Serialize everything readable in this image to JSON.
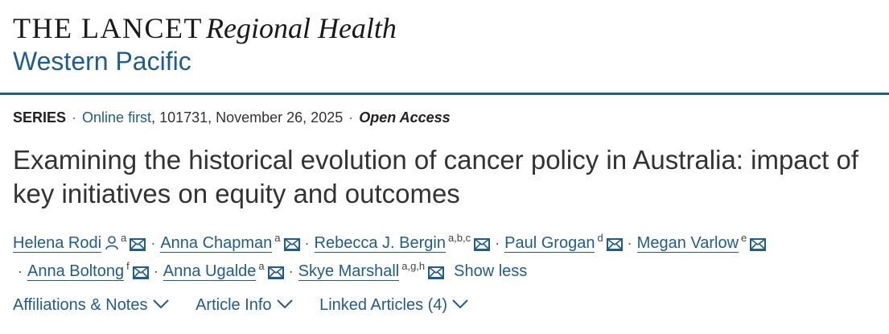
{
  "journal": {
    "name": "THE LANCET",
    "sub": "Regional Health",
    "region": "Western Pacific"
  },
  "meta": {
    "type": "SERIES",
    "online_first": "Online first",
    "details": ", 101731, November 26, 2025",
    "open_access": "Open Access"
  },
  "article": {
    "title": "Examining the historical evolution of cancer policy in Australia: impact of key initiatives on equity and outcomes"
  },
  "authors": [
    {
      "name": "Helena Rodi",
      "affil": "a"
    },
    {
      "name": "Anna Chapman",
      "affil": "a"
    },
    {
      "name": "Rebecca J. Bergin",
      "affil": "a,b,c"
    },
    {
      "name": "Paul Grogan",
      "affil": "d"
    },
    {
      "name": "Megan Varlow",
      "affil": "e"
    },
    {
      "name": "Anna Boltong",
      "affil": "f"
    },
    {
      "name": "Anna Ugalde",
      "affil": "a"
    },
    {
      "name": "Skye Marshall",
      "affil": "a,g,h"
    }
  ],
  "show_less": "Show less",
  "tabs": [
    {
      "label": "Affiliations & Notes"
    },
    {
      "label": "Article Info"
    },
    {
      "label": "Linked Articles (4)"
    }
  ],
  "colors": {
    "accent": "#1e5c94",
    "text": "#333333"
  }
}
